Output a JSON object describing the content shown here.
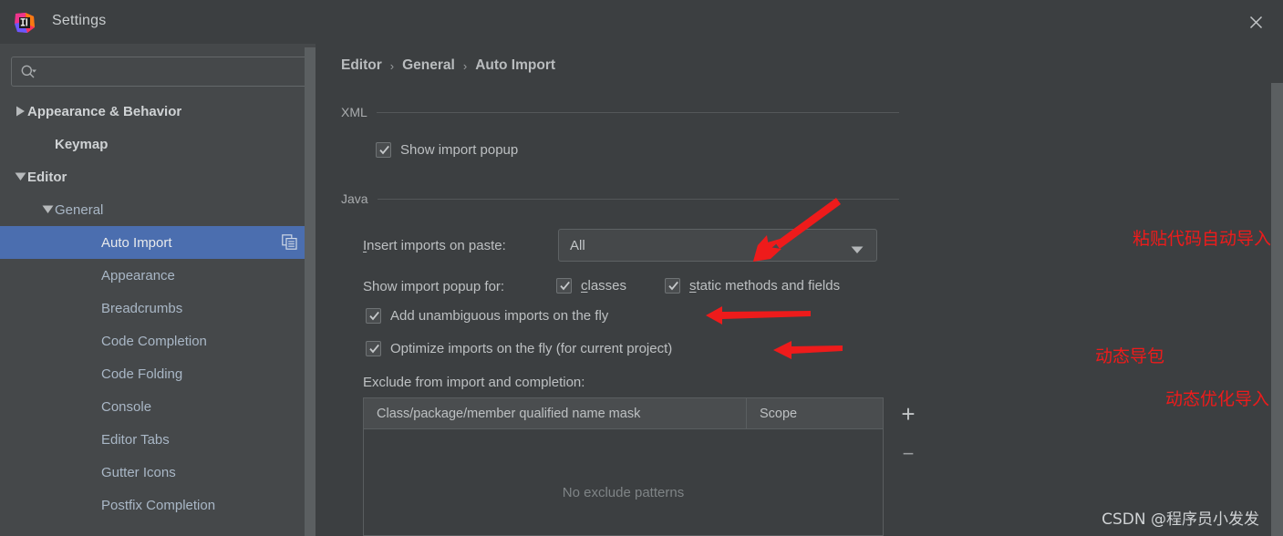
{
  "window": {
    "title": "Settings",
    "logo_icon": "intellij-idea-logo",
    "close_icon": "close-icon"
  },
  "sidebar": {
    "search": {
      "value": "",
      "placeholder": "",
      "icon": "search-icon"
    },
    "items": [
      {
        "label": "Appearance & Behavior",
        "level": 0,
        "arrow": "collapsed",
        "bold": true,
        "selected": false
      },
      {
        "label": "Keymap",
        "level": 1,
        "arrow": "none",
        "bold": true,
        "selected": false
      },
      {
        "label": "Editor",
        "level": 0,
        "arrow": "expanded",
        "bold": true,
        "selected": false
      },
      {
        "label": "General",
        "level": 2,
        "arrow": "expanded",
        "bold": false,
        "selected": false
      },
      {
        "label": "Auto Import",
        "level": 3,
        "arrow": "none",
        "bold": false,
        "selected": true,
        "badge_icon": "copy-icon"
      },
      {
        "label": "Appearance",
        "level": 3,
        "arrow": "none",
        "bold": false,
        "selected": false
      },
      {
        "label": "Breadcrumbs",
        "level": 3,
        "arrow": "none",
        "bold": false,
        "selected": false
      },
      {
        "label": "Code Completion",
        "level": 3,
        "arrow": "none",
        "bold": false,
        "selected": false
      },
      {
        "label": "Code Folding",
        "level": 3,
        "arrow": "none",
        "bold": false,
        "selected": false
      },
      {
        "label": "Console",
        "level": 3,
        "arrow": "none",
        "bold": false,
        "selected": false
      },
      {
        "label": "Editor Tabs",
        "level": 3,
        "arrow": "none",
        "bold": false,
        "selected": false
      },
      {
        "label": "Gutter Icons",
        "level": 3,
        "arrow": "none",
        "bold": false,
        "selected": false
      },
      {
        "label": "Postfix Completion",
        "level": 3,
        "arrow": "none",
        "bold": false,
        "selected": false
      }
    ]
  },
  "breadcrumb": {
    "crumb1": "Editor",
    "crumb2": "General",
    "crumb3": "Auto Import",
    "separator": "›"
  },
  "xml_section": {
    "group_label": "XML",
    "show_import_popup": {
      "label": "Show import popup",
      "checked": true
    }
  },
  "java_section": {
    "group_label": "Java",
    "insert_imports_label": "Insert imports on paste:",
    "insert_imports_value": "All",
    "insert_imports_mnemonic": "I",
    "show_import_popup_for_label": "Show import popup for:",
    "classes": {
      "label": "classes",
      "mnemonic": "c",
      "checked": true
    },
    "static_methods": {
      "label": "static methods and fields",
      "mnemonic": "s",
      "checked": true
    },
    "add_unambiguous": {
      "label": "Add unambiguous imports on the fly",
      "checked": true
    },
    "optimize_imports": {
      "label": "Optimize imports on the fly (for current project)",
      "checked": true
    },
    "exclude_label": "Exclude from import and completion:"
  },
  "exclude_table": {
    "columns": [
      "Class/package/member qualified name mask",
      "Scope"
    ],
    "rows": [],
    "empty_message": "No exclude patterns",
    "add_button": "+",
    "remove_button": "−"
  },
  "annotations": [
    {
      "text": "粘贴代码自动导入全部",
      "color": "#ee1b1b"
    },
    {
      "text": "动态导包",
      "color": "#ee1b1b"
    },
    {
      "text": "动态优化导入",
      "color": "#ee1b1b"
    }
  ],
  "watermark": "CSDN @程序员小发发",
  "colors": {
    "window_bg": "#3c3f41",
    "sidebar_bg": "#45484a",
    "selection": "#4b6eaf",
    "text": "#bdc0c2",
    "annotation_red": "#ee1b1b"
  }
}
